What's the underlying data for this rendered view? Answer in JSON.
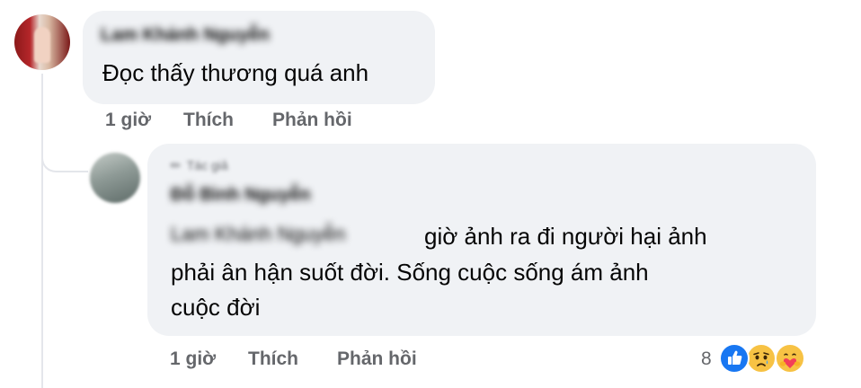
{
  "comment": {
    "author": "Lam Khánh Nguyễn",
    "text": "Đọc thấy thương quá anh",
    "time": "1 giờ",
    "like_label": "Thích",
    "reply_label": "Phản hồi"
  },
  "reply": {
    "badge": "Tác giả",
    "author": "Đỗ Bình Nguyễn",
    "mention": "Lam Khánh Nguyễn",
    "text_line1": "giờ ảnh ra đi người hại ảnh",
    "text_line2": "phải ân hận suốt đời. Sống cuộc sống ám ảnh",
    "text_line3": "cuộc đời",
    "time": "1 giờ",
    "like_label": "Thích",
    "reply_label": "Phản hồi",
    "reaction_count": "8",
    "reactions": [
      "like-icon",
      "sad-icon",
      "care-icon"
    ]
  },
  "colors": {
    "bubble": "#f0f2f5",
    "meta_text": "#65676b",
    "like_blue": "#1877f2",
    "emoji_yellow": "#f7c244"
  }
}
